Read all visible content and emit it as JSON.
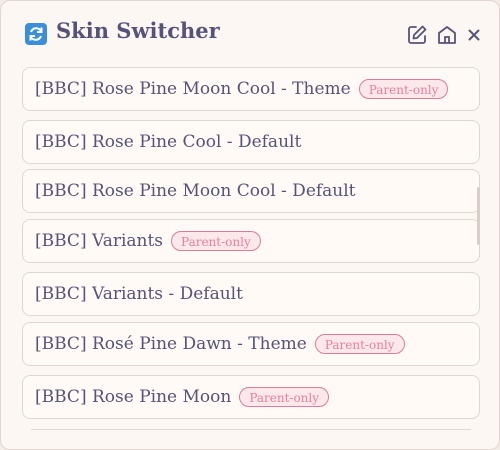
{
  "header": {
    "title": "Skin Switcher",
    "app_icon": "refresh-icon",
    "buttons": [
      "edit-icon",
      "home-icon",
      "close-icon"
    ]
  },
  "skins": [
    {
      "label": "[BBC] Rose Pine Moon Cool - Theme",
      "badge": "Parent-only"
    },
    {
      "label": "[BBC] Rose Pine Cool - Default"
    },
    {
      "label": "[BBC] Rose Pine Moon Cool - Default"
    },
    {
      "label": "[BBC] Variants",
      "badge": "Parent-only"
    },
    {
      "label": "[BBC] Variants - Default"
    },
    {
      "label": "[BBC] Rosé Pine Dawn - Theme",
      "badge": "Parent-only"
    },
    {
      "label": "[BBC] Rose Pine Moon",
      "badge": "Parent-only"
    }
  ],
  "colors": {
    "background": "#fdf7f3",
    "text": "#575279",
    "badge": "#e87fa0",
    "app_icon": "#3b8fd8"
  }
}
